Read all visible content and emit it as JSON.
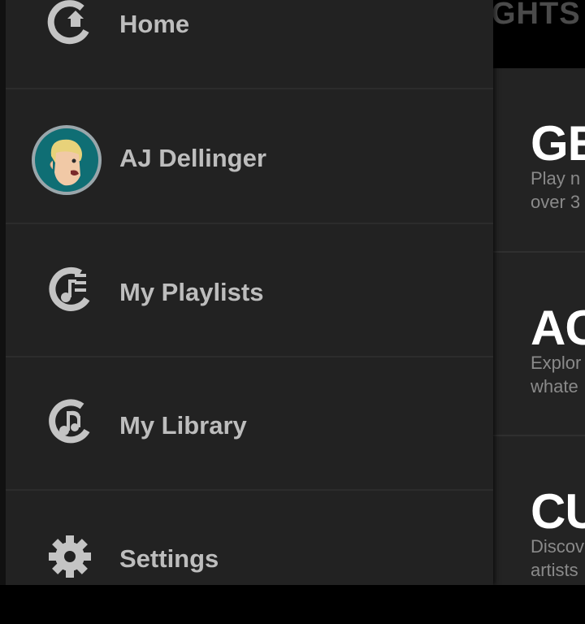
{
  "drawer": {
    "items": [
      {
        "label": "Home",
        "icon": "home-refresh-icon"
      },
      {
        "label": "AJ Dellinger",
        "icon": "avatar"
      },
      {
        "label": "My Playlists",
        "icon": "playlist-icon"
      },
      {
        "label": "My Library",
        "icon": "library-music-icon"
      },
      {
        "label": "Settings",
        "icon": "gear-icon"
      }
    ],
    "text_color": "#bdbdbd",
    "background": "#222222"
  },
  "main": {
    "header_title": "GHTS",
    "cards": [
      {
        "title": "GE",
        "desc_line1": "Play n",
        "desc_line2": "over 3"
      },
      {
        "title": "AC",
        "desc_line1": "Explor",
        "desc_line2": "whate"
      },
      {
        "title": "CU",
        "desc_line1": "Discov",
        "desc_line2": "artists"
      }
    ]
  },
  "colors": {
    "icon": "#c4c4c4",
    "accent_avatar": "#0f6e74"
  }
}
